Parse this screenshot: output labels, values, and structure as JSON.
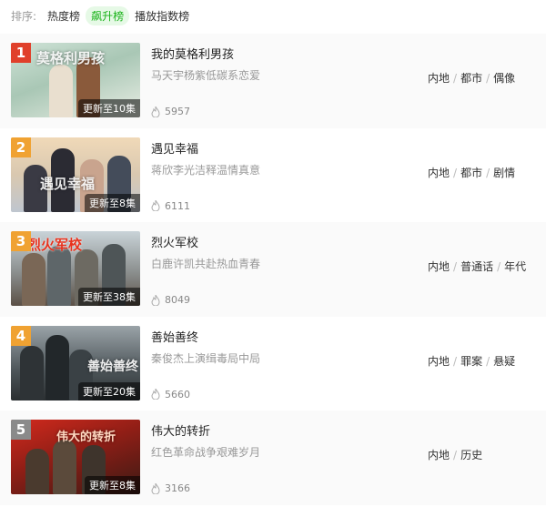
{
  "sort": {
    "label": "排序:",
    "options": [
      "热度榜",
      "飙升榜",
      "播放指数榜"
    ],
    "active_index": 1
  },
  "colors": {
    "accent": "#1bb31b",
    "rank_top": "#e0402b",
    "rank_other": "#f0a232"
  },
  "items": [
    {
      "rank": "1",
      "title": "我的莫格利男孩",
      "desc": "马天宇杨紫低碳系恋爱",
      "update": "更新至10集",
      "heat": "5957",
      "tags": [
        "内地",
        "都市",
        "偶像"
      ],
      "art_text": "莫格利男孩"
    },
    {
      "rank": "2",
      "title": "遇见幸福",
      "desc": "蒋欣李光洁释温情真意",
      "update": "更新至8集",
      "heat": "6111",
      "tags": [
        "内地",
        "都市",
        "剧情"
      ],
      "art_text": "遇见幸福"
    },
    {
      "rank": "3",
      "title": "烈火军校",
      "desc": "白鹿许凯共赴热血青春",
      "update": "更新至38集",
      "heat": "8049",
      "tags": [
        "内地",
        "普通话",
        "年代"
      ],
      "art_text": "烈火军校"
    },
    {
      "rank": "4",
      "title": "善始善终",
      "desc": "秦俊杰上演缉毒局中局",
      "update": "更新至20集",
      "heat": "5660",
      "tags": [
        "内地",
        "罪案",
        "悬疑"
      ],
      "art_text": "善始善终"
    },
    {
      "rank": "5",
      "title": "伟大的转折",
      "desc": "红色革命战争艰难岁月",
      "update": "更新至8集",
      "heat": "3166",
      "tags": [
        "内地",
        "历史"
      ],
      "art_text": "伟大的转折"
    }
  ]
}
